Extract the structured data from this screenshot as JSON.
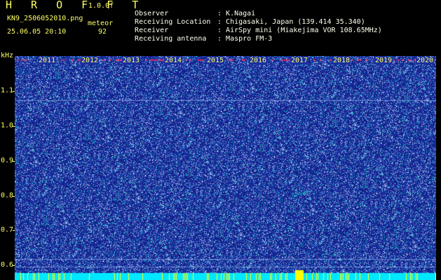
{
  "header": {
    "brand": "H R O F F T",
    "version": "1.0.0f",
    "filename": "KN9_2506052010.png",
    "datetime": "25.06.05 20:10",
    "meteor_label": "meteor",
    "meteor_count": "92"
  },
  "info": [
    {
      "label": "Observer",
      "value": "K.Nagai"
    },
    {
      "label": "Receiving Location",
      "value": "Chigasaki, Japan (139.414 35.340)"
    },
    {
      "label": "Receiver",
      "value": "AirSpy mini (Miakejima VOR 108.65MHz)"
    },
    {
      "label": "Receiving antenna",
      "value": "Maspro FM-3"
    }
  ],
  "plot": {
    "unit": "kHz",
    "y_labels": [
      "1.1",
      "1.0",
      "0.9",
      "0.8",
      "0.7",
      "0.6"
    ],
    "x_labels": [
      "2011",
      "2012",
      "2013",
      "2014",
      "2015",
      "2016",
      "2017",
      "2018",
      "2019",
      "2020"
    ]
  },
  "colors": {
    "background": "#1a2fa0",
    "text": "#ffff66",
    "noise_light": "#a0c8ff",
    "noise_cyan": "#00e0e0",
    "bottom_band": "#00e8ff"
  }
}
